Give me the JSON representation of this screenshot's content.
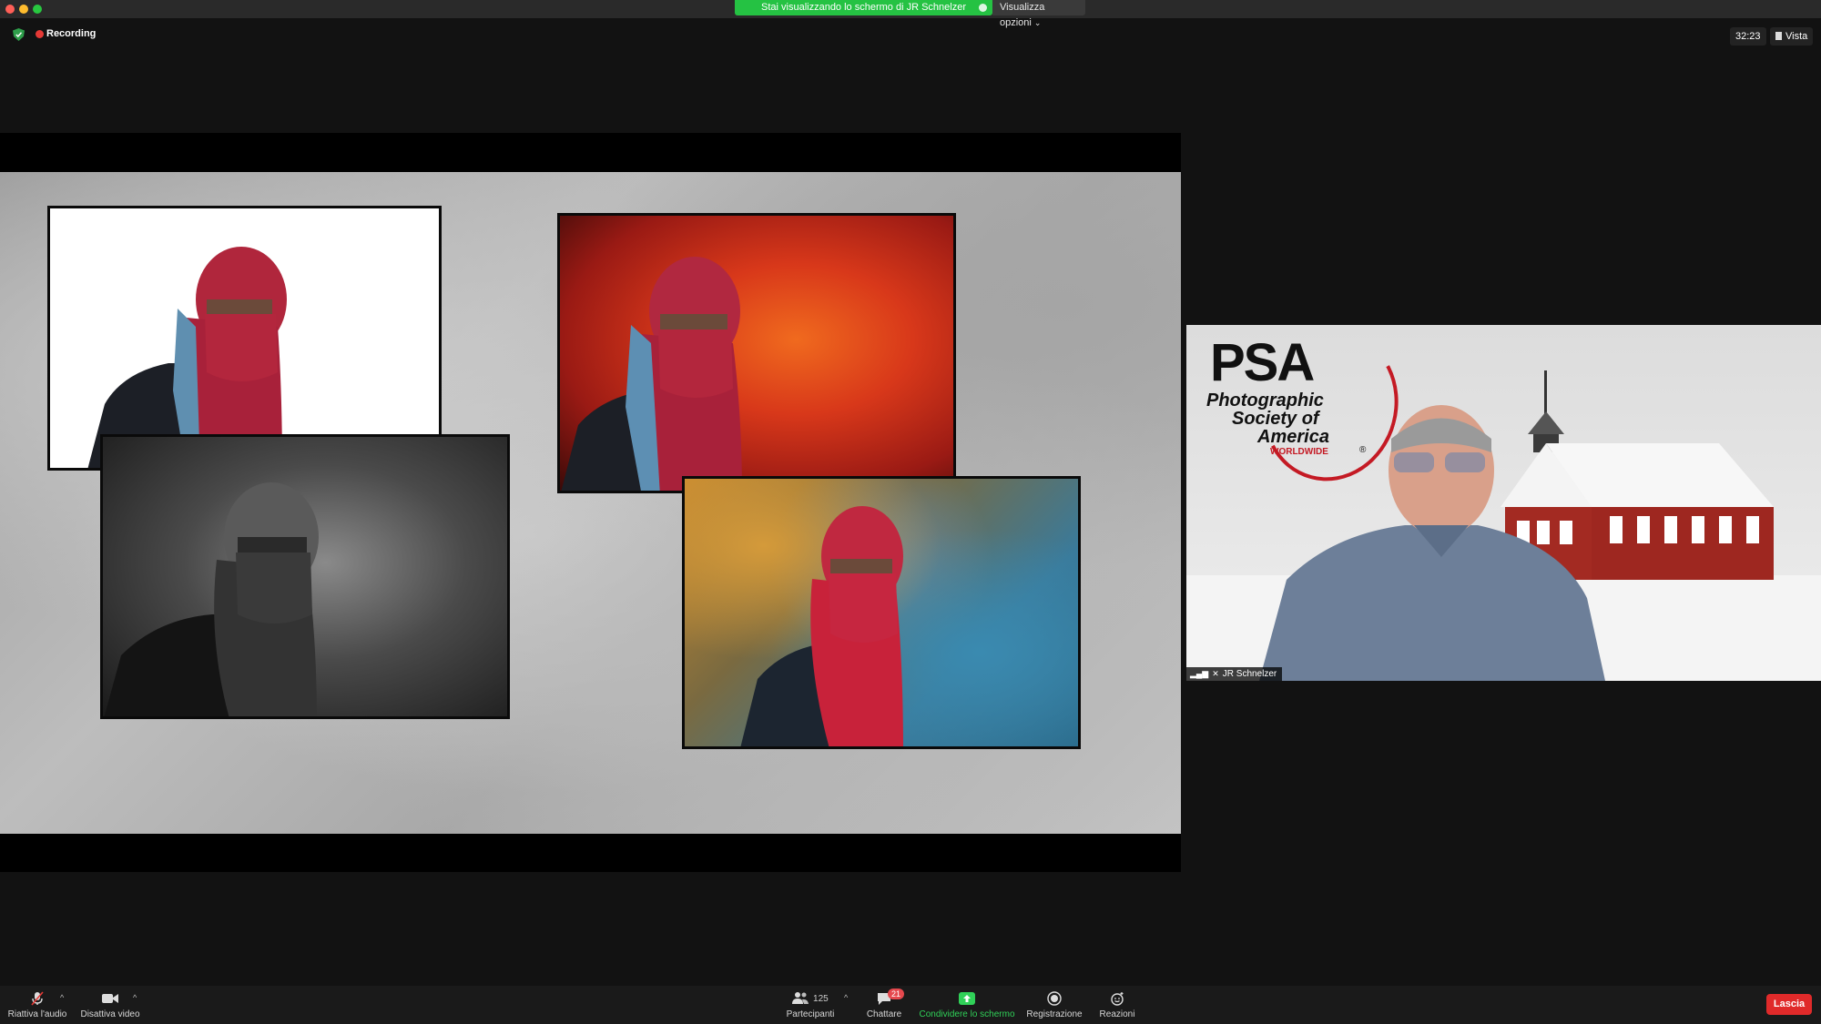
{
  "topbar": {
    "share_banner": "Stai visualizzando lo schermo di JR Schnelzer",
    "view_options": "Visualizza opzioni"
  },
  "status": {
    "recording_label": "Recording",
    "timer": "32:23",
    "view_label": "Vista"
  },
  "speaker": {
    "name": "JR Schnelzer",
    "logo_main": "PSA",
    "logo_line1": "Photographic",
    "logo_line2": "Society of",
    "logo_line3": "America",
    "logo_line4": "WORLDWIDE",
    "logo_mark": "®"
  },
  "toolbar": {
    "unmute_label": "Riattiva l'audio",
    "video_label": "Disattiva video",
    "participants_count": "125",
    "participants_label": "Partecipanti",
    "chat_label": "Chattare",
    "chat_badge": "21",
    "share_label": "Condividere lo schermo",
    "record_label": "Registrazione",
    "reactions_label": "Reazioni",
    "leave_label": "Lascia"
  },
  "colors": {
    "share_green": "#25c243",
    "leave_red": "#e02a2a",
    "recording_red": "#e53935",
    "psa_red": "#c41a24"
  },
  "icons": [
    "shield-icon",
    "microphone-muted-icon",
    "video-camera-icon",
    "participants-icon",
    "chat-icon",
    "share-screen-icon",
    "record-icon",
    "reactions-icon",
    "signal-icon",
    "pin-icon"
  ]
}
